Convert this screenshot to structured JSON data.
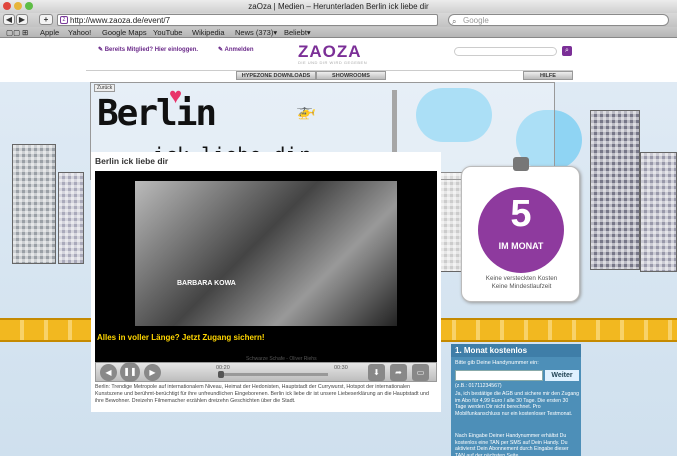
{
  "window": {
    "title": "zaOza | Medien – Herunterladen Berlin ick liebe dir"
  },
  "browser": {
    "url": "http://www.zaoza.de/event/7",
    "search_placeholder": "Google",
    "back": "◀",
    "forward": "▶",
    "add": "+"
  },
  "bookmarks": [
    "Apple",
    "Yahoo!",
    "Google Maps",
    "YouTube",
    "Wikipedia",
    "News (373)▾",
    "Beliebt▾"
  ],
  "site": {
    "member_link": "Bereits Mitglied? Hier einloggen.",
    "register_link": "Anmelden",
    "logo": "ZAOZA",
    "tagline": "DIE UND DIR WIRD GEGEBEN",
    "tabs": [
      "HYPEZONE DOWNLOADS",
      "SHOWROOMS",
      "HILFE"
    ]
  },
  "banner": {
    "back": "Zurück",
    "title": "Berlin",
    "subtitle": "ick liebe dir"
  },
  "content": {
    "title": "Berlin ick liebe dir",
    "video_name": "BARBARA KOWA",
    "promo": "Alles in voller Länge? Jetzt Zugang sichern!",
    "track": "Schwarze Schafe - Oliver Riehs",
    "time_start": "00:20",
    "time_end": "00:30",
    "description": "Berlin: Trendige Metropole auf internationalem Niveau, Heimat der Hedonisten, Hauptstadt der Currywurst, Hotspot der internationalen Kunstszene und berühmt-berüchtigt für ihre unfreundlichen Eingeborenen. Berlin ick liebe dir ist unsere Liebeserklärung an die Hauptstadt und ihre Bewohner. Dreizehn Filmemacher erzählen dreizehn Geschichten über die Stadt."
  },
  "offer": {
    "price": "5",
    "currency": "€",
    "period": "IM MONAT",
    "note1": "Keine versteckten Kosten",
    "note2": "Keine Mindestlaufzeit"
  },
  "signup": {
    "heading": "1. Monat kostenlos",
    "label": "Bitte gib Deine Handynummer ein:",
    "button": "Weiter",
    "example": "(z.B.: 01711234567)",
    "text1": "Ja, ich bestätige die AGB und sichere mir den Zugang im Abo für 4,99 Euro / alle 30 Tage. Die ersten 30 Tage werden Dir nicht berechnet. Pro Mobilfunkanschluss nur ein kostenloser Testmonat.",
    "text2": "Nach Eingabe Deiner Handynummer erhältst Du kostenlos eine TAN per SMS auf Dein Handy. Du aktivierst Dein Abonnement durch Eingabe dieser TAN auf der nächsten Seite."
  }
}
